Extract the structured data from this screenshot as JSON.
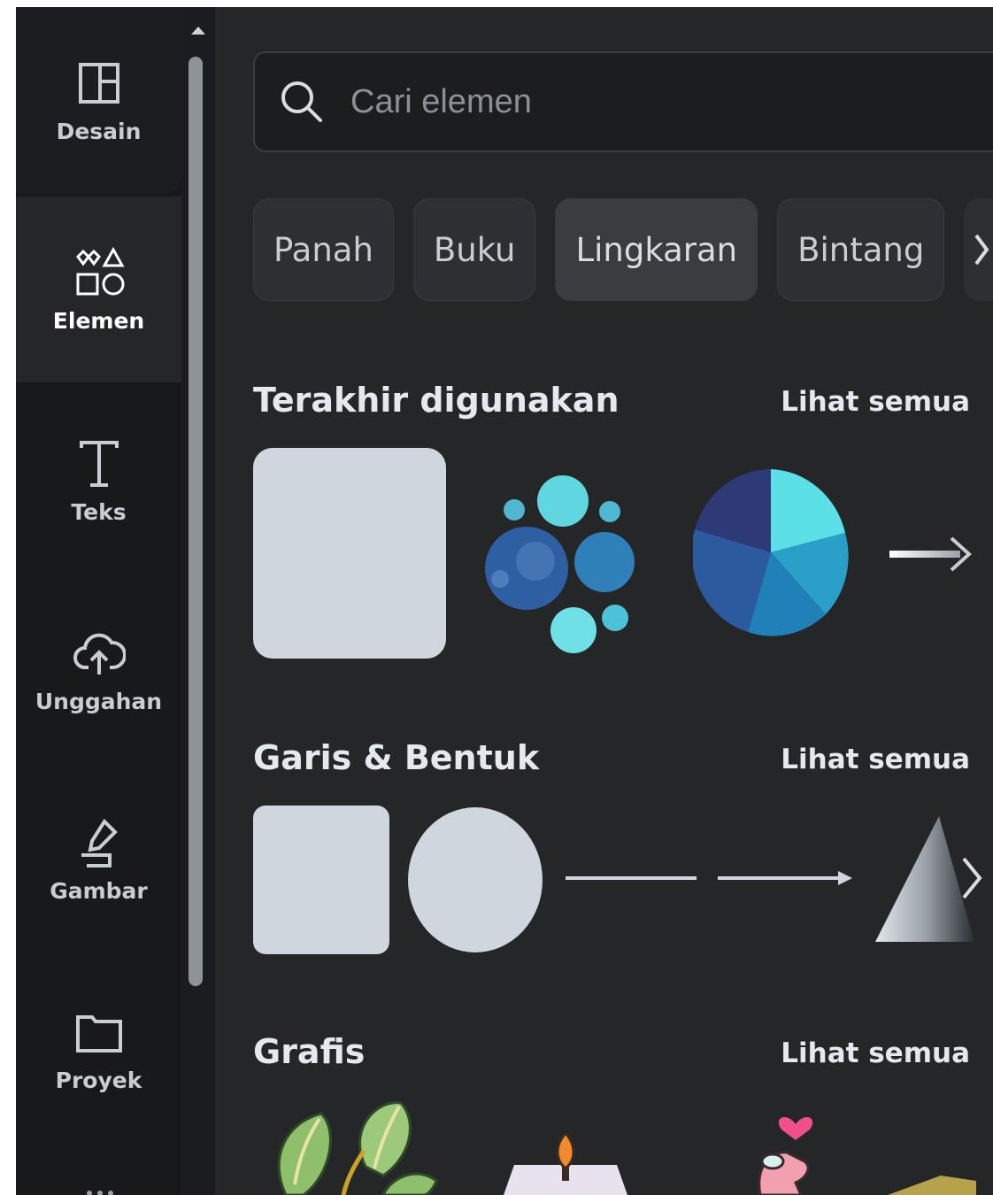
{
  "sidebar": {
    "items": [
      {
        "label": "Desain",
        "icon": "layout-icon"
      },
      {
        "label": "Elemen",
        "icon": "shapes-icon",
        "active": true
      },
      {
        "label": "Teks",
        "icon": "text-icon"
      },
      {
        "label": "Unggahan",
        "icon": "cloud-upload-icon"
      },
      {
        "label": "Gambar",
        "icon": "draw-icon"
      },
      {
        "label": "Proyek",
        "icon": "folder-icon"
      }
    ]
  },
  "search": {
    "placeholder": "Cari elemen"
  },
  "chips": [
    {
      "label": "Panah"
    },
    {
      "label": "Buku"
    },
    {
      "label": "Lingkaran",
      "active": true
    },
    {
      "label": "Bintang"
    }
  ],
  "sections": {
    "recent": {
      "title": "Terakhir digunakan",
      "see_all": "Lihat semua"
    },
    "shapes": {
      "title": "Garis & Bentuk",
      "see_all": "Lihat semua"
    },
    "graphics": {
      "title": "Grafis",
      "see_all": "Lihat semua"
    }
  },
  "colors": {
    "panel_bg": "#252628",
    "rail_bg": "#18191b",
    "shape_fill": "#cfd6de",
    "pie": [
      "#5be0e8",
      "#2aa0c8",
      "#2080b8",
      "#2c5a9e",
      "#2e3a78"
    ]
  }
}
